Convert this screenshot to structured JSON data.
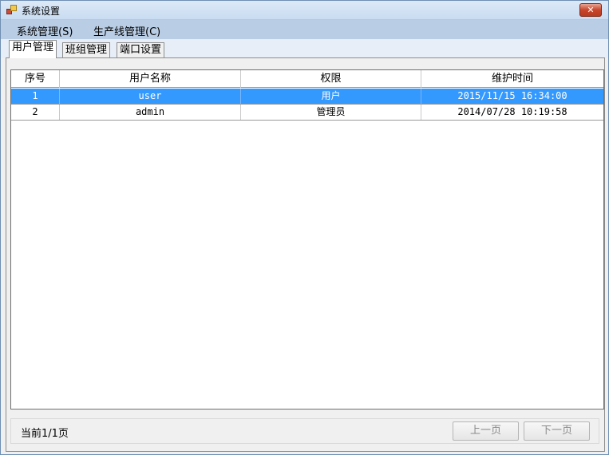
{
  "window": {
    "title": "系统设置",
    "close_glyph": "✕"
  },
  "menu": [
    {
      "label": "系统管理(S)"
    },
    {
      "label": "生产线管理(C)"
    }
  ],
  "tabs": [
    {
      "label": "用户管理",
      "active": true
    },
    {
      "label": "班组管理",
      "active": false
    },
    {
      "label": "端口设置",
      "active": false
    }
  ],
  "table": {
    "columns": [
      "序号",
      "用户名称",
      "权限",
      "维护时间"
    ],
    "rows": [
      {
        "index": "1",
        "name": "user",
        "role": "用户",
        "time": "2015/11/15 16:34:00",
        "selected": true
      },
      {
        "index": "2",
        "name": "admin",
        "role": "管理员",
        "time": "2014/07/28 10:19:58",
        "selected": false
      }
    ]
  },
  "pager": {
    "info": "当前1/1页",
    "prev_label": "上一页",
    "next_label": "下一页"
  },
  "colors": {
    "selection": "#3399ff",
    "menubar": "#b9cde5",
    "close_button": "#c7462c"
  }
}
